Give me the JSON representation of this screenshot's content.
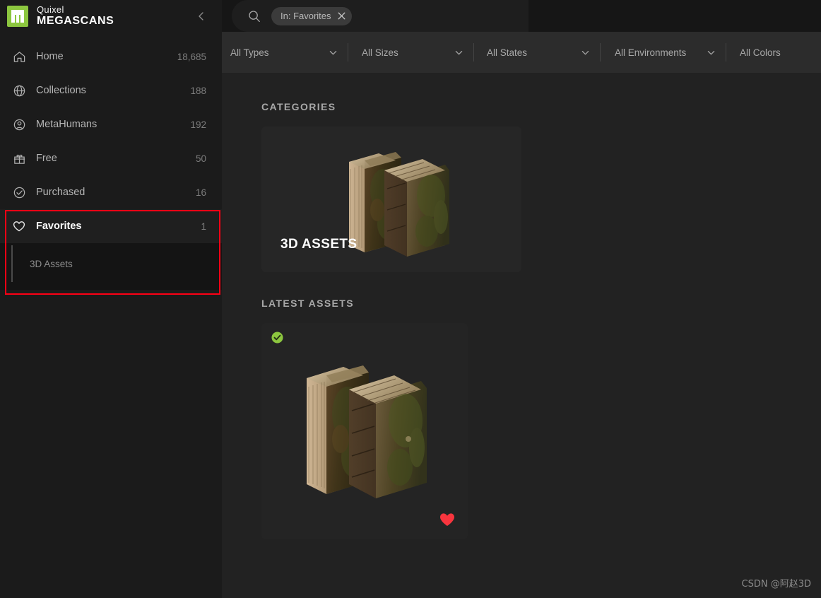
{
  "brand": {
    "line1": "Quixel",
    "line2": "MEGASCANS",
    "logo_icon": "megascans-m-logo",
    "logo_color": "#8cc63f",
    "collapse_icon": "chevron-left-icon"
  },
  "sidebar": {
    "items": [
      {
        "label": "Home",
        "count": "18,685",
        "icon": "home-icon",
        "active": false
      },
      {
        "label": "Collections",
        "count": "188",
        "icon": "globe-icon",
        "active": false
      },
      {
        "label": "MetaHumans",
        "count": "192",
        "icon": "user-circle-icon",
        "active": false
      },
      {
        "label": "Free",
        "count": "50",
        "icon": "gift-icon",
        "active": false
      },
      {
        "label": "Purchased",
        "count": "16",
        "icon": "check-circle-icon",
        "active": false
      },
      {
        "label": "Favorites",
        "count": "1",
        "icon": "heart-outline-icon",
        "active": true
      }
    ],
    "sub_items": [
      {
        "label": "3D Assets"
      }
    ],
    "annotation_color": "#ff0015"
  },
  "search": {
    "icon": "search-icon",
    "placeholder": "",
    "value": "",
    "chips": [
      {
        "label": "In: Favorites",
        "close_icon": "close-x-icon"
      }
    ]
  },
  "filters": [
    {
      "label": "All Types",
      "icon": "chevron-down-icon",
      "has_chevron": true
    },
    {
      "label": "All Sizes",
      "icon": "chevron-down-icon",
      "has_chevron": true
    },
    {
      "label": "All States",
      "icon": "chevron-down-icon",
      "has_chevron": true
    },
    {
      "label": "All Environments",
      "icon": "chevron-down-icon",
      "has_chevron": true
    },
    {
      "label": "All Colors",
      "icon": "chevron-down-icon",
      "has_chevron": false
    }
  ],
  "sections": {
    "categories_heading": "CATEGORIES",
    "latest_heading": "LATEST ASSETS"
  },
  "categories": [
    {
      "title": "3D ASSETS",
      "thumbnail": "antique-books-thumbnail"
    }
  ],
  "latest_assets": [
    {
      "thumbnail": "antique-books-thumbnail",
      "downloaded_badge_icon": "check-circle-filled-icon",
      "downloaded_badge_color": "#8cc63f",
      "favorite_badge_icon": "heart-filled-icon",
      "favorite_badge_color": "#f8353e"
    }
  ],
  "watermark": "CSDN @阿赵3D",
  "theme": {
    "sidebar_bg": "#1b1b1b",
    "subnav_bg": "#141414",
    "topbar_bg": "#161616",
    "filterbar_bg": "#2c2c2c",
    "content_bg": "#222222",
    "accent_green": "#8cc63f",
    "accent_red": "#f8353e"
  }
}
